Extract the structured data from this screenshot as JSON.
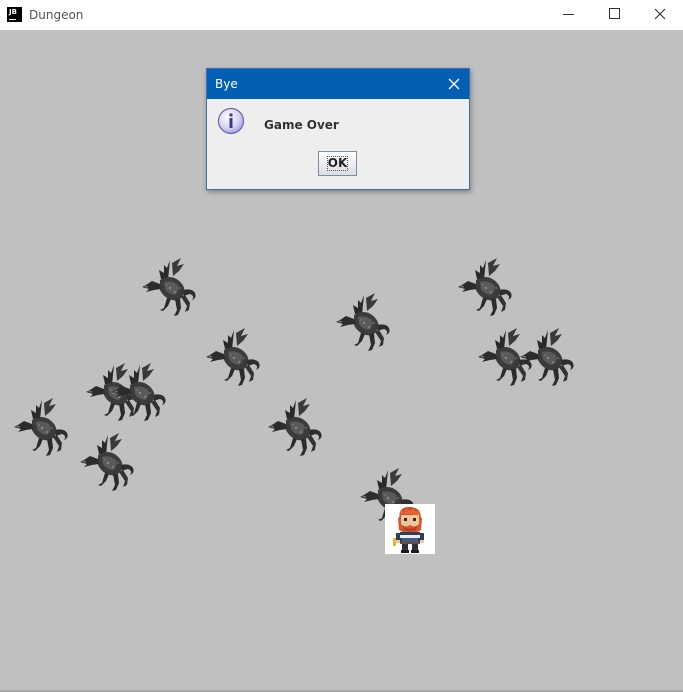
{
  "window": {
    "title": "Dungeon",
    "icon_text": "JB",
    "icon": "jetbrains-app-icon"
  },
  "window_controls": {
    "minimize_icon": "minimize-icon",
    "maximize_icon": "maximize-icon",
    "close_icon": "close-icon"
  },
  "dialog": {
    "title": "Bye",
    "message": "Game Over",
    "button_label": "OK",
    "icon": "info-icon",
    "close_icon": "close-icon"
  },
  "game": {
    "background_color": "#c0c0c0",
    "dragon_count": 13,
    "player_sprite": "bearded-warrior",
    "enemy_sprite": "black-dragon"
  },
  "colors": {
    "dialog_titlebar": "#0160b4",
    "dialog_body": "#eeeeee",
    "playfield": "#c0c0c0"
  }
}
